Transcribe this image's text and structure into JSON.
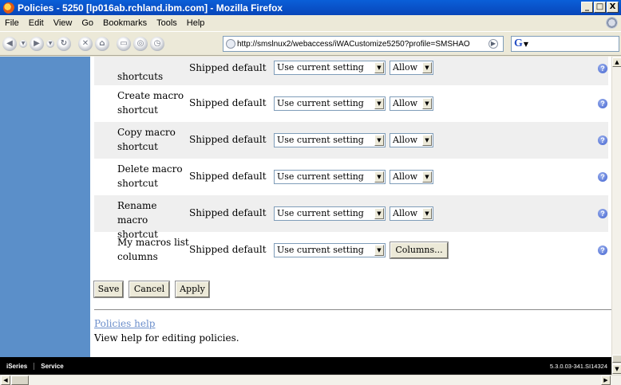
{
  "window": {
    "title": "Policies - 5250 [lp016ab.rchland.ibm.com] - Mozilla Firefox",
    "controls": [
      "_",
      "□",
      "X"
    ]
  },
  "menubar": {
    "items": [
      "File",
      "Edit",
      "View",
      "Go",
      "Bookmarks",
      "Tools",
      "Help"
    ]
  },
  "navbar": {
    "url": "http://smslnux2/webaccess/iWACustomize5250?profile=SMSHAO",
    "search_logo": "G"
  },
  "policies": {
    "rows": [
      {
        "name": "shortcuts",
        "source": "Shipped default",
        "setting": "Use current setting",
        "access": "Allow"
      },
      {
        "name": "Create macro shortcut",
        "source": "Shipped default",
        "setting": "Use current setting",
        "access": "Allow"
      },
      {
        "name": "Copy macro shortcut",
        "source": "Shipped default",
        "setting": "Use current setting",
        "access": "Allow"
      },
      {
        "name": "Delete macro shortcut",
        "source": "Shipped default",
        "setting": "Use current setting",
        "access": "Allow"
      },
      {
        "name": "Rename macro shortcut",
        "source": "Shipped default",
        "setting": "Use current setting",
        "access": "Allow"
      },
      {
        "name": "My macros list columns",
        "source": "Shipped default",
        "setting": "Use current setting",
        "button": "Columns..."
      }
    ],
    "help_glyph": "?"
  },
  "actions": {
    "save": "Save",
    "cancel": "Cancel",
    "apply": "Apply"
  },
  "help": {
    "link": "Policies help",
    "text": "View help for editing policies."
  },
  "footer": {
    "tabs": [
      "iSeries",
      "Service"
    ],
    "version": "5.3.0.03-341.SI14324"
  },
  "icons": {
    "dropdown": "▼",
    "scroll_up": "▲",
    "scroll_down": "▼",
    "scroll_left": "◀",
    "scroll_right": "▶"
  }
}
